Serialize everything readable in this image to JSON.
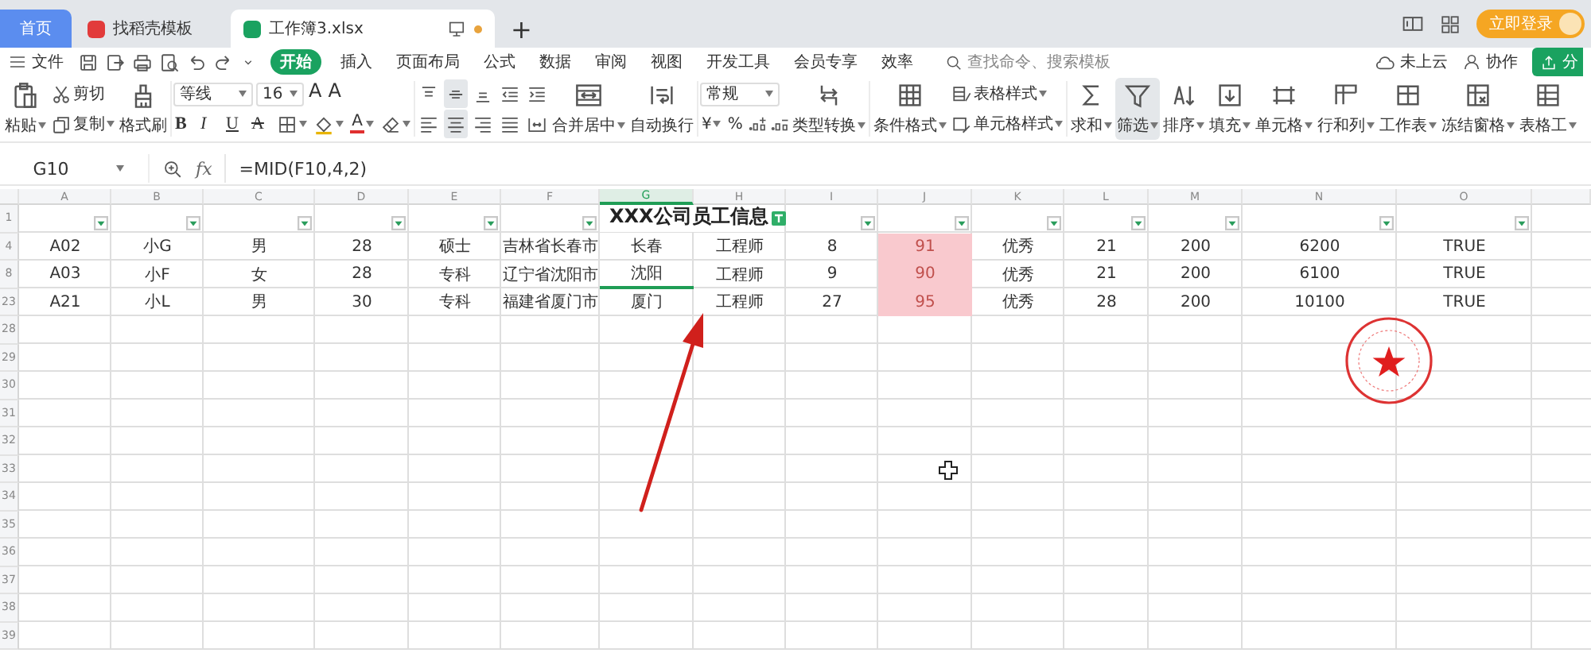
{
  "tabs": [
    {
      "label": "首页",
      "kind": "home",
      "selected": false,
      "unsaved": false
    },
    {
      "label": "找稻壳模板",
      "kind": "docer",
      "selected": false,
      "unsaved": false
    },
    {
      "label": "工作簿3.xlsx",
      "kind": "sheet",
      "selected": true,
      "unsaved": true
    }
  ],
  "new_tab": "+",
  "login": "立即登录",
  "menu": {
    "file": "文件",
    "tabs": [
      {
        "label": "开始",
        "selected": true
      },
      {
        "label": "插入",
        "selected": false
      },
      {
        "label": "页面布局",
        "selected": false
      },
      {
        "label": "公式",
        "selected": false
      },
      {
        "label": "数据",
        "selected": false
      },
      {
        "label": "审阅",
        "selected": false
      },
      {
        "label": "视图",
        "selected": false
      },
      {
        "label": "开发工具",
        "selected": false
      },
      {
        "label": "会员专享",
        "selected": false
      },
      {
        "label": "效率",
        "selected": false
      }
    ],
    "search": {
      "placeholder": "查找命令、搜索模板"
    },
    "cloud": "未上云",
    "collab": "协作",
    "share": "分"
  },
  "ribbon": {
    "paste": "粘贴",
    "cut": "剪切",
    "copy": "复制",
    "format_painter": "格式刷",
    "font_family": "等线",
    "font_size": "16",
    "font_grow": "A",
    "font_shrink": "A",
    "format_buttons": [
      {
        "label": "B",
        "kind": "bold"
      },
      {
        "label": "I",
        "kind": "italic"
      },
      {
        "label": "U",
        "kind": "underline"
      },
      {
        "label": "A",
        "kind": "strikethrough"
      }
    ],
    "font_color": "A",
    "align_buttons": [
      {
        "kind": "top",
        "selected": false
      },
      {
        "kind": "middle",
        "selected": true
      },
      {
        "kind": "bottom",
        "selected": false
      },
      {
        "kind": "outdent",
        "selected": false
      },
      {
        "kind": "indent",
        "selected": false
      },
      {
        "kind": "left",
        "selected": false
      },
      {
        "kind": "center",
        "selected": true
      },
      {
        "kind": "right",
        "selected": false
      },
      {
        "kind": "justify",
        "selected": false
      },
      {
        "kind": "distributed",
        "selected": false
      }
    ],
    "merge": "合并居中",
    "wrap": "自动换行",
    "number_format": "常规",
    "currency": "¥",
    "percent": "%",
    "convert": "类型转换",
    "conditional": "条件格式",
    "table_style": "表格样式",
    "cell_style": "单元格样式",
    "tools": [
      {
        "label": "求和",
        "kind": "sum",
        "selected": false
      },
      {
        "label": "筛选",
        "kind": "filter",
        "selected": true
      },
      {
        "label": "排序",
        "kind": "sort",
        "selected": false
      },
      {
        "label": "填充",
        "kind": "fill",
        "selected": false
      },
      {
        "label": "单元格",
        "kind": "cell",
        "selected": false
      },
      {
        "label": "行和列",
        "kind": "rowcol",
        "selected": false
      },
      {
        "label": "工作表",
        "kind": "sheet",
        "selected": false
      },
      {
        "label": "冻结窗格",
        "kind": "freeze",
        "selected": false
      },
      {
        "label": "表格工",
        "kind": "table",
        "selected": false
      }
    ]
  },
  "formula_bar": {
    "name_box": "G10",
    "fx": "fx",
    "formula": "=MID(F10,4,2)"
  },
  "sheet": {
    "columns": [
      {
        "letter": "A",
        "selected": false,
        "filter": true
      },
      {
        "letter": "B",
        "selected": false,
        "filter": true
      },
      {
        "letter": "C",
        "selected": false,
        "filter": true
      },
      {
        "letter": "D",
        "selected": false,
        "filter": true
      },
      {
        "letter": "E",
        "selected": false,
        "filter": true
      },
      {
        "letter": "F",
        "selected": false,
        "filter": true
      },
      {
        "letter": "G",
        "selected": true,
        "filter": false
      },
      {
        "letter": "H",
        "selected": false,
        "filter": false
      },
      {
        "letter": "I",
        "selected": false,
        "filter": true
      },
      {
        "letter": "J",
        "selected": false,
        "filter": true
      },
      {
        "letter": "K",
        "selected": false,
        "filter": true
      },
      {
        "letter": "L",
        "selected": false,
        "filter": true
      },
      {
        "letter": "M",
        "selected": false,
        "filter": true
      },
      {
        "letter": "N",
        "selected": false,
        "filter": true
      },
      {
        "letter": "O",
        "selected": false,
        "filter": true
      }
    ],
    "rows": [
      {
        "label": "1",
        "title": "XXX公司员工信息"
      },
      {
        "label": "4",
        "cells": [
          {
            "text": "A02",
            "selected": false,
            "highlighted": false
          },
          {
            "text": "小G",
            "selected": false,
            "highlighted": false
          },
          {
            "text": "男",
            "selected": false,
            "highlighted": false
          },
          {
            "text": "28",
            "selected": false,
            "highlighted": false
          },
          {
            "text": "硕士",
            "selected": false,
            "highlighted": false
          },
          {
            "text": "吉林省长春市",
            "selected": false,
            "highlighted": false
          },
          {
            "text": "长春",
            "selected": false,
            "highlighted": false
          },
          {
            "text": "工程师",
            "selected": false,
            "highlighted": false
          },
          {
            "text": "8",
            "selected": false,
            "highlighted": false
          },
          {
            "text": "91",
            "selected": false,
            "highlighted": true
          },
          {
            "text": "优秀",
            "selected": false,
            "highlighted": false
          },
          {
            "text": "21",
            "selected": false,
            "highlighted": false
          },
          {
            "text": "200",
            "selected": false,
            "highlighted": false
          },
          {
            "text": "6200",
            "selected": false,
            "highlighted": false
          },
          {
            "text": "TRUE",
            "selected": false,
            "highlighted": false
          }
        ]
      },
      {
        "label": "8",
        "cells": [
          {
            "text": "A03",
            "selected": false,
            "highlighted": false
          },
          {
            "text": "小F",
            "selected": false,
            "highlighted": false
          },
          {
            "text": "女",
            "selected": false,
            "highlighted": false
          },
          {
            "text": "28",
            "selected": false,
            "highlighted": false
          },
          {
            "text": "专科",
            "selected": false,
            "highlighted": false
          },
          {
            "text": "辽宁省沈阳市",
            "selected": false,
            "highlighted": false
          },
          {
            "text": "沈阳",
            "selected": true,
            "highlighted": false
          },
          {
            "text": "工程师",
            "selected": false,
            "highlighted": false
          },
          {
            "text": "9",
            "selected": false,
            "highlighted": false
          },
          {
            "text": "90",
            "selected": false,
            "highlighted": true
          },
          {
            "text": "优秀",
            "selected": false,
            "highlighted": false
          },
          {
            "text": "21",
            "selected": false,
            "highlighted": false
          },
          {
            "text": "200",
            "selected": false,
            "highlighted": false
          },
          {
            "text": "6100",
            "selected": false,
            "highlighted": false
          },
          {
            "text": "TRUE",
            "selected": false,
            "highlighted": false
          }
        ]
      },
      {
        "label": "23",
        "cells": [
          {
            "text": "A21",
            "selected": false,
            "highlighted": false
          },
          {
            "text": "小L",
            "selected": false,
            "highlighted": false
          },
          {
            "text": "男",
            "selected": false,
            "highlighted": false
          },
          {
            "text": "30",
            "selected": false,
            "highlighted": false
          },
          {
            "text": "专科",
            "selected": false,
            "highlighted": false
          },
          {
            "text": "福建省厦门市",
            "selected": false,
            "highlighted": false
          },
          {
            "text": "厦门",
            "selected": false,
            "highlighted": false
          },
          {
            "text": "工程师",
            "selected": false,
            "highlighted": false
          },
          {
            "text": "27",
            "selected": false,
            "highlighted": false
          },
          {
            "text": "95",
            "selected": false,
            "highlighted": true
          },
          {
            "text": "优秀",
            "selected": false,
            "highlighted": false
          },
          {
            "text": "28",
            "selected": false,
            "highlighted": false
          },
          {
            "text": "200",
            "selected": false,
            "highlighted": false
          },
          {
            "text": "10100",
            "selected": false,
            "highlighted": false
          },
          {
            "text": "TRUE",
            "selected": false,
            "highlighted": false
          }
        ]
      },
      {
        "label": "28"
      },
      {
        "label": "29"
      },
      {
        "label": "30"
      },
      {
        "label": "31"
      },
      {
        "label": "32"
      },
      {
        "label": "33"
      },
      {
        "label": "34"
      },
      {
        "label": "35"
      },
      {
        "label": "36"
      },
      {
        "label": "37"
      },
      {
        "label": "38"
      },
      {
        "label": "39"
      }
    ]
  }
}
